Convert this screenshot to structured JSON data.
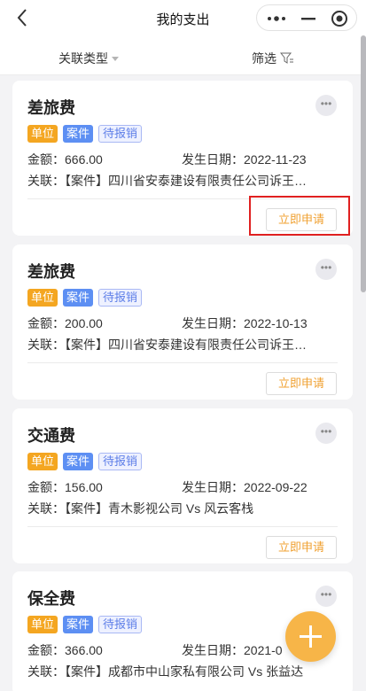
{
  "nav": {
    "title": "我的支出"
  },
  "filter": {
    "type_label": "关联类型",
    "screen_label": "筛选"
  },
  "labels": {
    "amount_prefix": "金额：",
    "date_prefix": "发生日期：",
    "relation_prefix": "关联：",
    "more": "•••"
  },
  "colors": {
    "accent": "#f0a132",
    "unit_tag": "#f4a621",
    "case_tag": "#5d8ff3",
    "fab": "#f7b548",
    "highlight": "#e02020"
  },
  "cards": [
    {
      "title": "差旅费",
      "tags": [
        "单位",
        "案件",
        "待报销"
      ],
      "amount": "金额：666.00",
      "date": "发生日期：2022-11-23",
      "relation": "关联：【案件】四川省安泰建设有限责任公司诉王…",
      "button": "立即申请"
    },
    {
      "title": "差旅费",
      "tags": [
        "单位",
        "案件",
        "待报销"
      ],
      "amount": "金额：200.00",
      "date": "发生日期：2022-10-13",
      "relation": "关联：【案件】四川省安泰建设有限责任公司诉王…",
      "button": "立即申请"
    },
    {
      "title": "交通费",
      "tags": [
        "单位",
        "案件",
        "待报销"
      ],
      "amount": "金额：156.00",
      "date": "发生日期：2022-09-22",
      "relation": "关联：【案件】青木影视公司 Vs 风云客栈",
      "button": "立即申请"
    },
    {
      "title": "保全费",
      "tags": [
        "单位",
        "案件",
        "待报销"
      ],
      "amount": "金额：366.00",
      "date": "发生日期：2021-0",
      "relation": "关联：【案件】成都市中山家私有限公司 Vs 张益达",
      "button": ""
    }
  ]
}
